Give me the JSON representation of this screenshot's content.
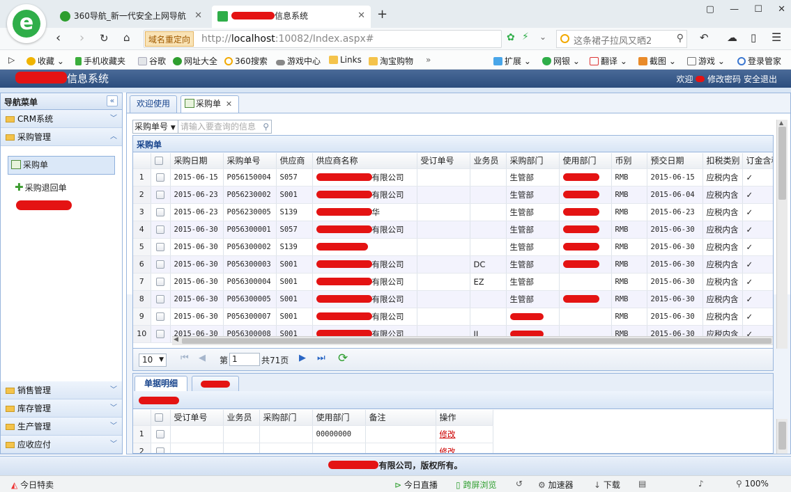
{
  "browser": {
    "tabs": [
      {
        "label": "360导航_新一代安全上网导航",
        "active": false
      },
      {
        "label": "信息系统",
        "active": true
      }
    ],
    "new_tab": "+",
    "window_controls": [
      "▢",
      "—",
      "☐",
      "✕"
    ],
    "redirect_badge": "域名重定向",
    "url": {
      "scheme": "http://",
      "host": "localhost",
      "rest": ":10082/Index.aspx#"
    },
    "search_text": "这条裙子拉风又晒2",
    "bookmarks": [
      {
        "label": "收藏",
        "icon": "star-icon",
        "color": "#f0b400"
      },
      {
        "label": "手机收藏夹",
        "icon": "phone-icon",
        "color": "#3cae3c"
      },
      {
        "label": "谷歌",
        "icon": "page-icon",
        "color": "#cfd4d8"
      },
      {
        "label": "网址大全",
        "icon": "plus-badge-icon",
        "color": "#2e9e2e"
      },
      {
        "label": "360搜索",
        "icon": "search-icon",
        "color": "#f2a900"
      },
      {
        "label": "游戏中心",
        "icon": "gamepad-icon",
        "color": "#777777"
      },
      {
        "label": "Links",
        "icon": "folder-icon",
        "color": "#f4c34b"
      },
      {
        "label": "淘宝购物",
        "icon": "folder-icon",
        "color": "#f4c34b"
      }
    ],
    "toolbar_right": [
      {
        "label": "扩展",
        "icon": "grid-icon"
      },
      {
        "label": "网银",
        "icon": "shield-icon"
      },
      {
        "label": "翻译",
        "icon": "translate-icon"
      },
      {
        "label": "截图",
        "icon": "scissors-icon"
      },
      {
        "label": "游戏",
        "icon": "gamepad-icon"
      },
      {
        "label": "登录管家",
        "icon": "user-icon"
      }
    ]
  },
  "app": {
    "title_suffix": "信息系统",
    "welcome": "欢迎",
    "change_password": "修改密码",
    "logout": "安全退出"
  },
  "nav": {
    "title": "导航菜单",
    "collapse": "«",
    "sections_top": [
      {
        "label": "CRM系统",
        "expanded": false
      },
      {
        "label": "采购管理",
        "expanded": true
      }
    ],
    "items": [
      {
        "label": "采购单",
        "selected": true
      },
      {
        "label": "采购退回单",
        "selected": false
      }
    ],
    "sections_bottom": [
      "销售管理",
      "库存管理",
      "生产管理",
      "应收应付"
    ]
  },
  "tabs": [
    {
      "label": "欢迎使用",
      "active": false
    },
    {
      "label": "采购单",
      "active": true,
      "closable": true
    }
  ],
  "search": {
    "field": "采购单号",
    "placeholder": "请输入要查询的信息"
  },
  "grid": {
    "title": "采购单",
    "columns": [
      "采购日期",
      "采购单号",
      "供应商",
      "供应商名称",
      "受订单号",
      "业务员",
      "采购部门",
      "使用部门",
      "币别",
      "预交日期",
      "扣税类别",
      "订金含税"
    ],
    "rows": [
      {
        "n": "1",
        "date": "2015-06-15",
        "no": "P056150004",
        "sup": "S057",
        "name": "有限公司",
        "order": "",
        "emp": "",
        "dept": "生管部",
        "curr": "RMB",
        "due": "2015-06-15",
        "tax": "应税内含",
        "dep": "✓"
      },
      {
        "n": "2",
        "date": "2015-06-23",
        "no": "P056230002",
        "sup": "S001",
        "name": "有限公司",
        "order": "",
        "emp": "",
        "dept": "生管部",
        "curr": "RMB",
        "due": "2015-06-04",
        "tax": "应税内含",
        "dep": "✓"
      },
      {
        "n": "3",
        "date": "2015-06-23",
        "no": "P056230005",
        "sup": "S139",
        "name": "华",
        "order": "",
        "emp": "",
        "dept": "生管部",
        "curr": "RMB",
        "due": "2015-06-23",
        "tax": "应税内含",
        "dep": "✓"
      },
      {
        "n": "4",
        "date": "2015-06-30",
        "no": "P056300001",
        "sup": "S057",
        "name": "有限公司",
        "order": "",
        "emp": "",
        "dept": "生管部",
        "curr": "RMB",
        "due": "2015-06-30",
        "tax": "应税内含",
        "dep": "✓"
      },
      {
        "n": "5",
        "date": "2015-06-30",
        "no": "P056300002",
        "sup": "S139",
        "name": "",
        "order": "",
        "emp": "",
        "dept": "生管部",
        "curr": "RMB",
        "due": "2015-06-30",
        "tax": "应税内含",
        "dep": "✓"
      },
      {
        "n": "6",
        "date": "2015-06-30",
        "no": "P056300003",
        "sup": "S001",
        "name": "有限公司",
        "order": "",
        "emp": "DC",
        "dept": "生管部",
        "curr": "RMB",
        "due": "2015-06-30",
        "tax": "应税内含",
        "dep": "✓"
      },
      {
        "n": "7",
        "date": "2015-06-30",
        "no": "P056300004",
        "sup": "S001",
        "name": "有限公司",
        "order": "",
        "emp": "EZ",
        "dept": "生管部",
        "curr": "RMB",
        "due": "2015-06-30",
        "tax": "应税内含",
        "dep": "✓"
      },
      {
        "n": "8",
        "date": "2015-06-30",
        "no": "P056300005",
        "sup": "S001",
        "name": "有限公司",
        "order": "",
        "emp": "",
        "dept": "生管部",
        "curr": "RMB",
        "due": "2015-06-30",
        "tax": "应税内含",
        "dep": "✓"
      },
      {
        "n": "9",
        "date": "2015-06-30",
        "no": "P056300007",
        "sup": "S001",
        "name": "有限公司",
        "order": "",
        "emp": "",
        "dept": "",
        "curr": "RMB",
        "due": "2015-06-30",
        "tax": "应税内含",
        "dep": "✓"
      },
      {
        "n": "10",
        "date": "2015-06-30",
        "no": "P056300008",
        "sup": "S001",
        "name": "有限公司",
        "order": "",
        "emp": "JL",
        "dept": "",
        "curr": "RMB",
        "due": "2015-06-30",
        "tax": "应税内含",
        "dep": "✓"
      }
    ]
  },
  "pager": {
    "page_size": "10",
    "page_prefix": "第",
    "page": "1",
    "total": "共71页"
  },
  "detail": {
    "tabs": [
      "单据明细"
    ],
    "columns": [
      "受订单号",
      "业务员",
      "采购部门",
      "使用部门",
      "备注",
      "操作"
    ],
    "rows": [
      {
        "n": "1",
        "order": "",
        "emp": "",
        "dept": "",
        "use": "00000000",
        "note": "",
        "op": "修改"
      },
      {
        "n": "2",
        "order": "",
        "emp": "",
        "dept": "",
        "use": "",
        "note": "",
        "op": "修改"
      }
    ]
  },
  "footer": {
    "text": "有限公司，版权所有。"
  },
  "statusbar": {
    "left": "今日特卖",
    "items": [
      "今日直播",
      "跨屏浏览",
      "加速器",
      "下载"
    ],
    "zoom": "100%"
  },
  "colors": {
    "redaction": "#e41313",
    "header": "#2b4d7e",
    "border": "#98b5dc",
    "accent": "#3b6cb0"
  }
}
